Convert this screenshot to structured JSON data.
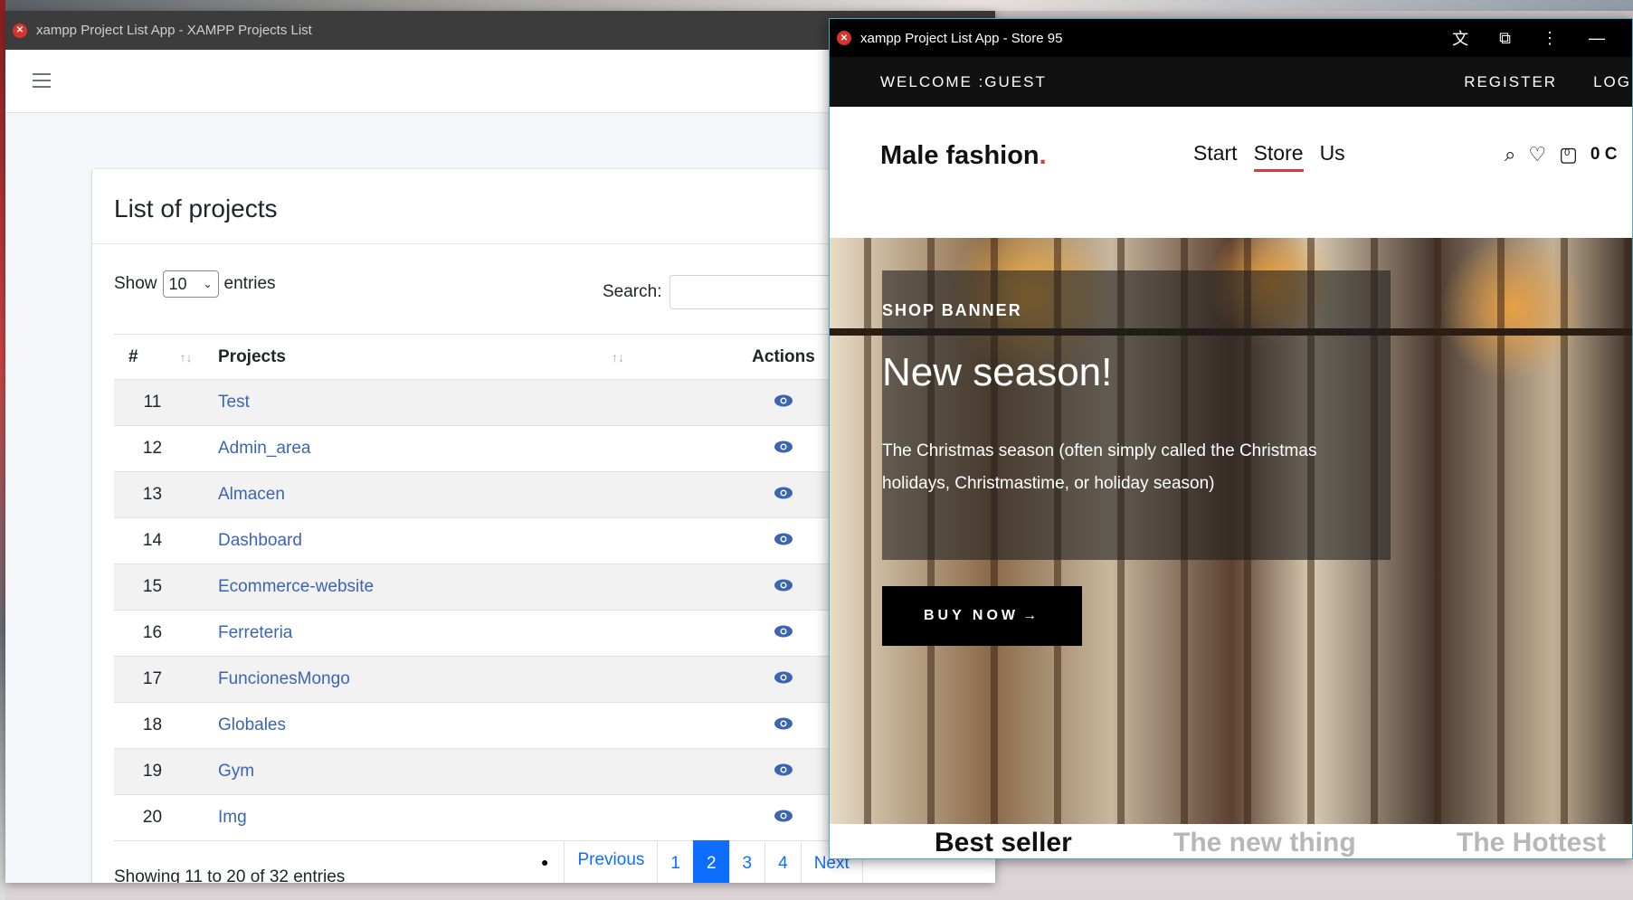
{
  "window1": {
    "title": "xampp Project List App - XAMPP Projects List",
    "card_title": "List of projects",
    "show_label": "Show",
    "entries_select": "10",
    "entries_label": "entries",
    "search_label": "Search:",
    "columns": [
      "#",
      "Projects",
      "Actions"
    ],
    "rows": [
      {
        "num": "11",
        "project": "Test"
      },
      {
        "num": "12",
        "project": "Admin_area"
      },
      {
        "num": "13",
        "project": "Almacen"
      },
      {
        "num": "14",
        "project": "Dashboard"
      },
      {
        "num": "15",
        "project": "Ecommerce-website"
      },
      {
        "num": "16",
        "project": "Ferreteria"
      },
      {
        "num": "17",
        "project": "FuncionesMongo"
      },
      {
        "num": "18",
        "project": "Globales"
      },
      {
        "num": "19",
        "project": "Gym"
      },
      {
        "num": "20",
        "project": "Img"
      }
    ],
    "info": "Showing 11 to 20 of 32 entries",
    "pagination": {
      "prev": "Previous",
      "pages": [
        "1",
        "2",
        "3",
        "4"
      ],
      "active": "2",
      "next": "Next"
    }
  },
  "window2": {
    "title": "xampp Project List App - Store 95",
    "welcome": "WELCOME :GUEST",
    "register": "REGISTER",
    "login": "LOGIN",
    "logo_text": "Male fashion",
    "logo_dot": ".",
    "menu": [
      "Start",
      "Store",
      "Us"
    ],
    "menu_active": "Store",
    "cart_count": "0",
    "cart_total": "0 C",
    "banner_kicker": "SHOP BANNER",
    "banner_title": "New season!",
    "banner_text": "The Christmas season (often simply called the Christmas holidays, Christmastime, or holiday season)",
    "buy_button": "BUY NOW",
    "tabs": [
      "Best seller",
      "The new thing",
      "The Hottest"
    ]
  },
  "colors": {
    "link": "#3c64b4",
    "pager_active": "#0d6efd",
    "accent_red": "#e53637"
  }
}
